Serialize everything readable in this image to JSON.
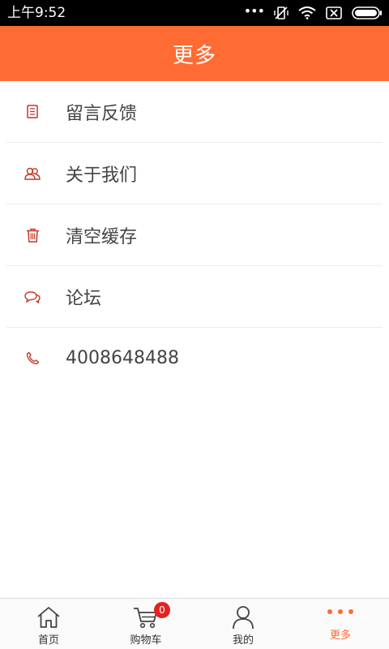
{
  "status_bar": {
    "time": "上午9:52",
    "icons": [
      "more-dots-icon",
      "vibrate-off-icon",
      "wifi-icon",
      "sim-x-icon",
      "battery-icon"
    ]
  },
  "header": {
    "title": "更多"
  },
  "menu": {
    "items": [
      {
        "label": "留言反馈",
        "icon": "document-icon"
      },
      {
        "label": "关于我们",
        "icon": "people-icon"
      },
      {
        "label": "清空缓存",
        "icon": "trash-icon"
      },
      {
        "label": "论坛",
        "icon": "chat-bubbles-icon"
      },
      {
        "label": "4008648488",
        "icon": "phone-icon"
      }
    ]
  },
  "bottom_nav": {
    "items": [
      {
        "label": "首页",
        "icon": "home-icon"
      },
      {
        "label": "购物车",
        "icon": "cart-icon",
        "badge": "0"
      },
      {
        "label": "我的",
        "icon": "user-icon"
      },
      {
        "label": "更多",
        "icon": "more-icon",
        "active": true
      }
    ]
  },
  "colors": {
    "accent": "#fe6c33",
    "icon_red": "#c0392b",
    "badge": "#e32222"
  }
}
